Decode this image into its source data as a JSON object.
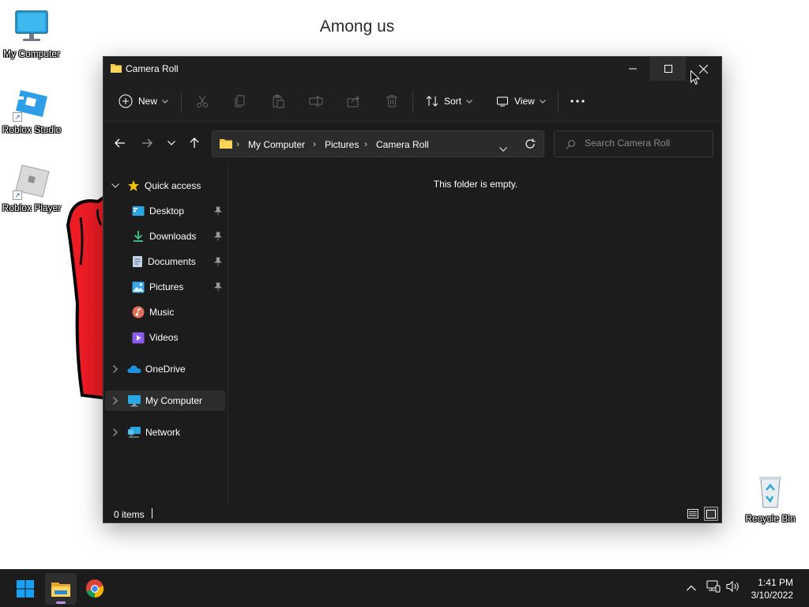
{
  "desktop": {
    "wallpaper_title": "Among us",
    "icons": [
      {
        "label": "My Computer",
        "icon": "monitor-icon"
      },
      {
        "label": "Roblox Studio",
        "icon": "roblox-studio-icon"
      },
      {
        "label": "Roblox Player",
        "icon": "roblox-player-icon"
      },
      {
        "label": "Recycle Bin",
        "icon": "recycle-bin-icon"
      }
    ]
  },
  "window": {
    "title": "Camera Roll",
    "toolbar": {
      "new_label": "New",
      "sort_label": "Sort",
      "view_label": "View",
      "icons": [
        "cut-icon",
        "copy-icon",
        "paste-icon",
        "rename-icon",
        "share-icon",
        "delete-icon",
        "more-icon"
      ]
    },
    "address": {
      "breadcrumbs": [
        "My Computer",
        "Pictures",
        "Camera Roll"
      ]
    },
    "search": {
      "placeholder": "Search Camera Roll"
    },
    "nav": {
      "quick_access": "Quick access",
      "items": [
        {
          "label": "Desktop",
          "icon": "desktop-folder-icon",
          "pinned": true
        },
        {
          "label": "Downloads",
          "icon": "downloads-icon",
          "pinned": true
        },
        {
          "label": "Documents",
          "icon": "documents-icon",
          "pinned": true
        },
        {
          "label": "Pictures",
          "icon": "pictures-icon",
          "pinned": true
        },
        {
          "label": "Music",
          "icon": "music-icon",
          "pinned": false
        },
        {
          "label": "Videos",
          "icon": "videos-icon",
          "pinned": false
        }
      ],
      "onedrive": "OneDrive",
      "my_computer": "My Computer",
      "network": "Network"
    },
    "empty_message": "This folder is empty.",
    "status": {
      "item_count": "0 items"
    }
  },
  "taskbar": {
    "time": "1:41 PM",
    "date": "3/10/2022",
    "apps": [
      "start-icon",
      "file-explorer-icon",
      "chrome-icon"
    ]
  },
  "colors": {
    "window_bg": "#1c1c1c",
    "accent_folder": "#f4c542",
    "selected_bg": "#2d2d2d"
  }
}
